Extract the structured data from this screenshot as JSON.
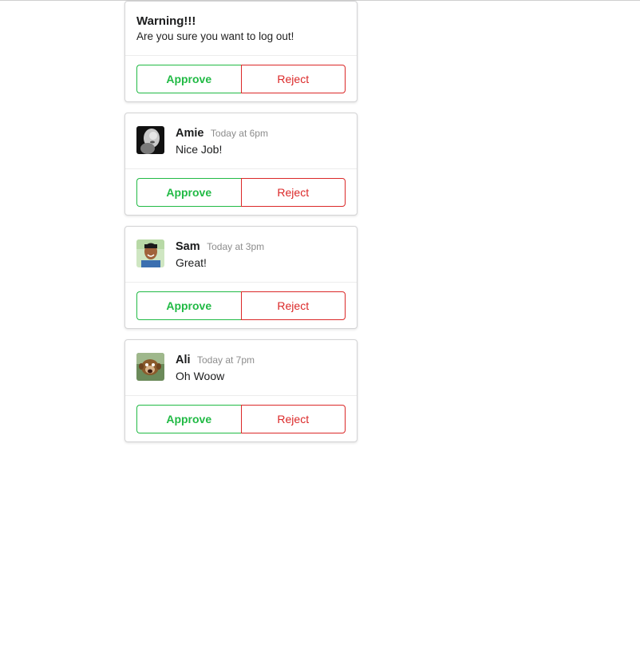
{
  "warning_card": {
    "title": "Warning!!!",
    "message": "Are you sure you want to log out!",
    "approve_label": "Approve",
    "reject_label": "Reject"
  },
  "feed_cards": [
    {
      "name": "Amie",
      "time": "Today at 6pm",
      "comment": "Nice Job!",
      "approve_label": "Approve",
      "reject_label": "Reject"
    },
    {
      "name": "Sam",
      "time": "Today at 3pm",
      "comment": "Great!",
      "approve_label": "Approve",
      "reject_label": "Reject"
    },
    {
      "name": "Ali",
      "time": "Today at 7pm",
      "comment": "Oh Woow",
      "approve_label": "Approve",
      "reject_label": "Reject"
    }
  ],
  "colors": {
    "approve": "#21ba45",
    "reject": "#db2828",
    "border": "#d4d4d5"
  }
}
